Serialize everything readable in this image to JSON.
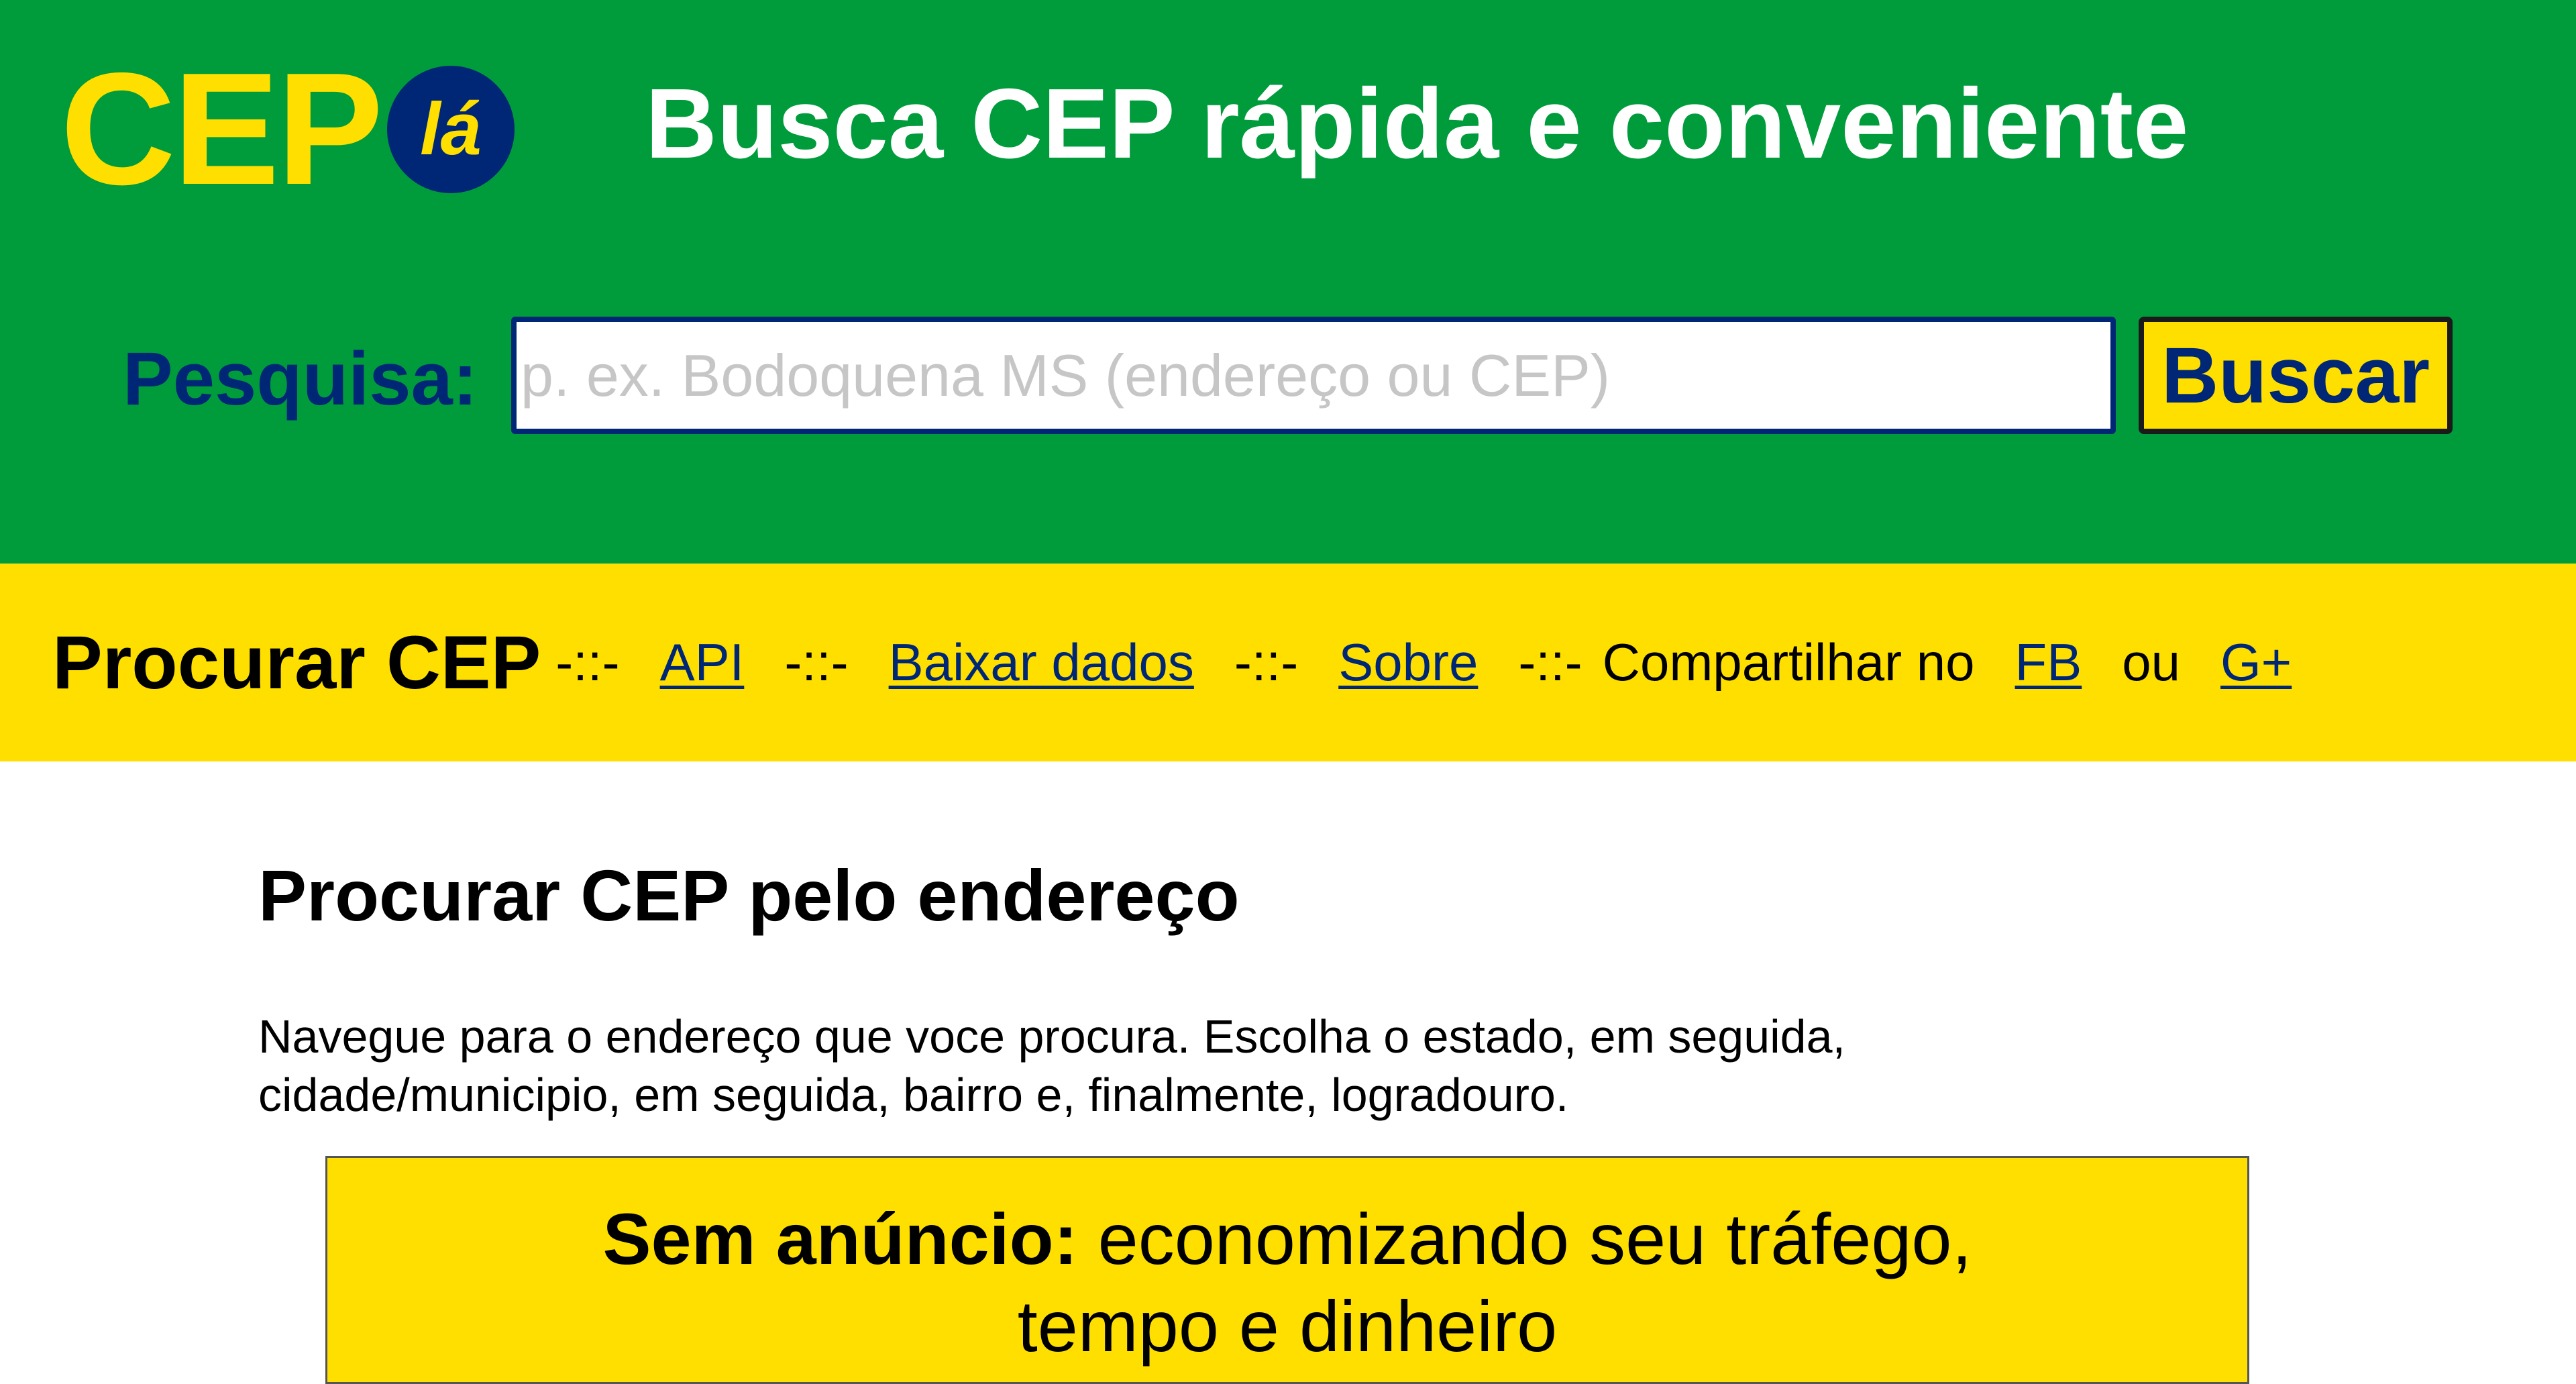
{
  "header": {
    "logo_text": "CEP",
    "logo_badge": "lá",
    "tagline": "Busca CEP rápida e conveniente",
    "search": {
      "label": "Pesquisa:",
      "value": "",
      "placeholder": "p. ex. Bodoquena MS (endereço ou CEP)",
      "button_label": "Buscar"
    }
  },
  "nav": {
    "title": "Procurar CEP",
    "separator": "-::-",
    "links": {
      "api": "API",
      "download": "Baixar dados",
      "about": "Sobre",
      "fb": "FB",
      "gplus": "G+"
    },
    "share_text": "Compartilhar no",
    "or_text": "ou"
  },
  "main": {
    "title": "Procurar CEP pelo endereço",
    "intro_line1": "Navegue para o endereço que voce procura. Escolha o estado, em seguida,",
    "intro_line2": "cidade/municipio, em seguida, bairro e, finalmente, logradouro.",
    "notice": {
      "strong": "Sem anúncio:",
      "rest_line1": " economizando seu tráfego,",
      "line2": "tempo e dinheiro"
    }
  },
  "colors": {
    "green": "#009c3b",
    "yellow": "#fedf00",
    "blue": "#002776"
  }
}
